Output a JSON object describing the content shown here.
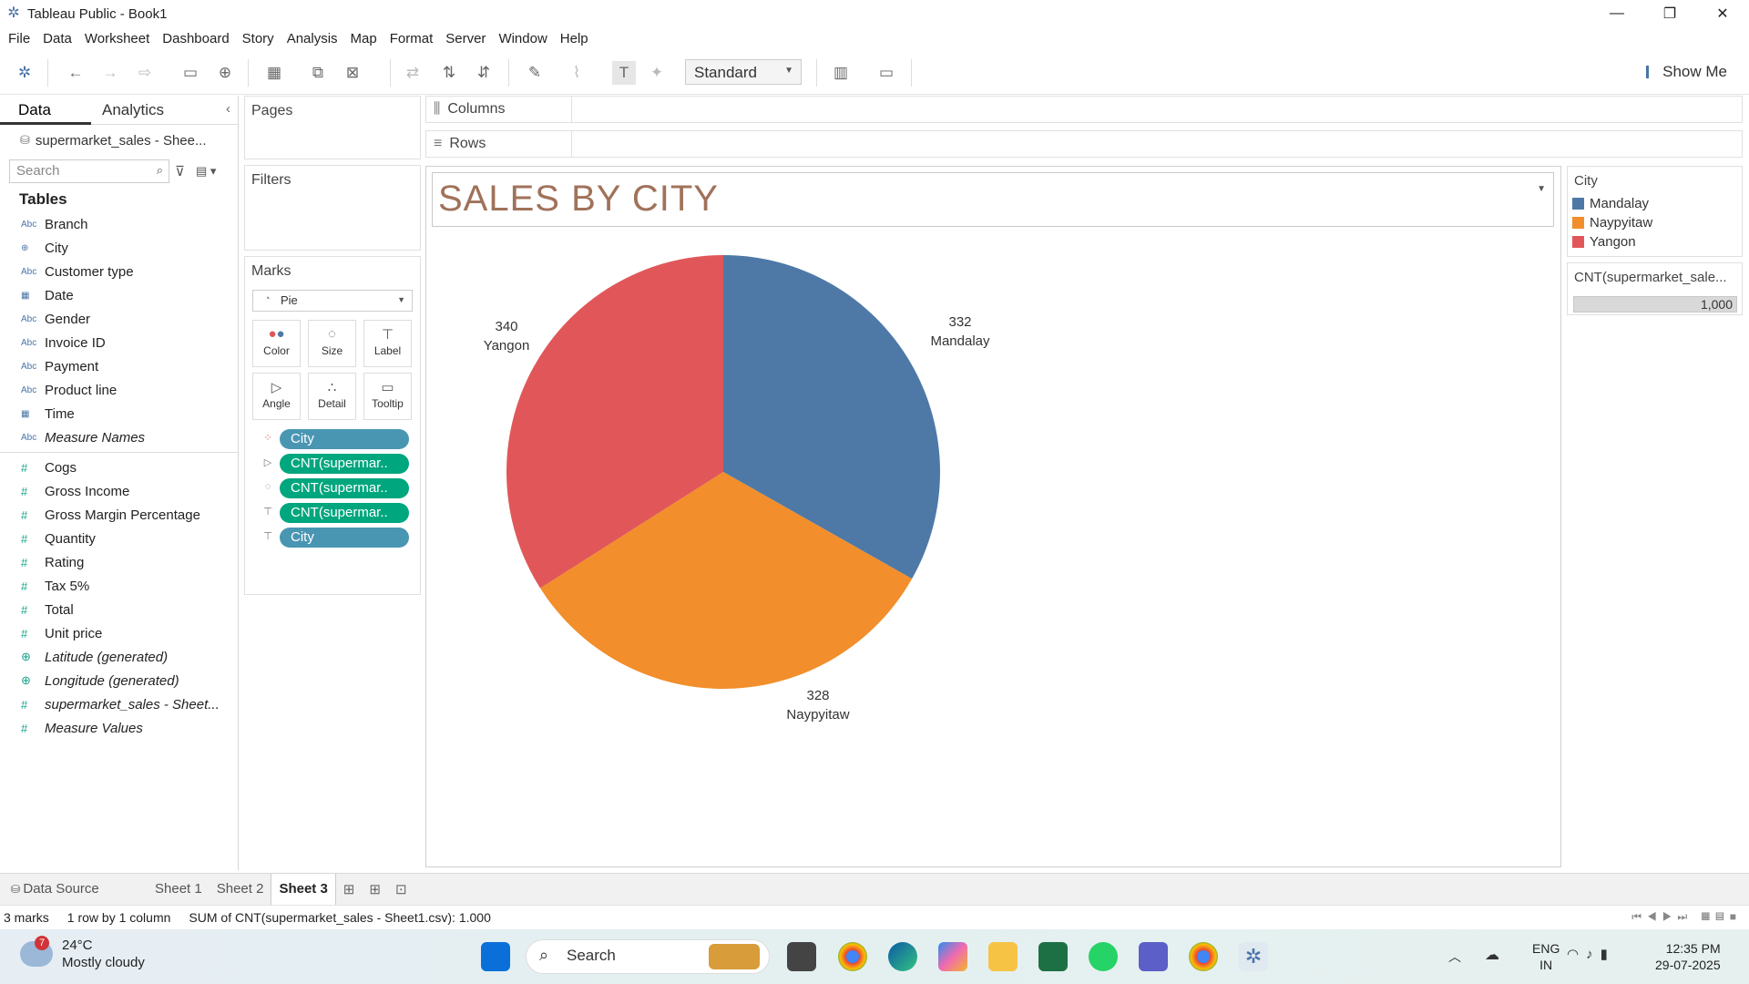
{
  "window": {
    "title": "Tableau Public - Book1"
  },
  "menu": [
    "File",
    "Data",
    "Worksheet",
    "Dashboard",
    "Story",
    "Analysis",
    "Map",
    "Format",
    "Server",
    "Window",
    "Help"
  ],
  "toolbar": {
    "fit_select": "Standard",
    "show_me": "Show Me"
  },
  "data_pane": {
    "tabs": [
      "Data",
      "Analytics"
    ],
    "datasource": "supermarket_sales - Shee...",
    "search_placeholder": "Search",
    "tables_heading": "Tables",
    "dimensions": [
      {
        "name": "Branch",
        "type": "Abc"
      },
      {
        "name": "City",
        "type": "geo"
      },
      {
        "name": "Customer type",
        "type": "Abc"
      },
      {
        "name": "Date",
        "type": "date"
      },
      {
        "name": "Gender",
        "type": "Abc"
      },
      {
        "name": "Invoice ID",
        "type": "Abc"
      },
      {
        "name": "Payment",
        "type": "Abc"
      },
      {
        "name": "Product line",
        "type": "Abc"
      },
      {
        "name": "Time",
        "type": "datetime"
      },
      {
        "name": "Measure Names",
        "type": "Abc",
        "italic": true
      }
    ],
    "measures": [
      {
        "name": "Cogs"
      },
      {
        "name": "Gross Income"
      },
      {
        "name": "Gross Margin Percentage"
      },
      {
        "name": "Quantity"
      },
      {
        "name": "Rating"
      },
      {
        "name": "Tax 5%"
      },
      {
        "name": "Total"
      },
      {
        "name": "Unit price"
      },
      {
        "name": "Latitude (generated)",
        "italic": true,
        "geo": true
      },
      {
        "name": "Longitude (generated)",
        "italic": true,
        "geo": true
      },
      {
        "name": "supermarket_sales - Sheet...",
        "italic": true
      },
      {
        "name": "Measure Values",
        "italic": true
      }
    ]
  },
  "shelves": {
    "pages": "Pages",
    "filters": "Filters",
    "marks": "Marks",
    "columns": "Columns",
    "rows": "Rows"
  },
  "marks": {
    "type": "Pie",
    "buttons": [
      "Color",
      "Size",
      "Label",
      "Angle",
      "Detail",
      "Tooltip"
    ],
    "pills": [
      {
        "label": "City",
        "kind": "dim",
        "role": "color"
      },
      {
        "label": "CNT(supermar..",
        "kind": "meas",
        "role": "angle"
      },
      {
        "label": "CNT(supermar..",
        "kind": "meas",
        "role": "size"
      },
      {
        "label": "CNT(supermar..",
        "kind": "meas",
        "role": "label"
      },
      {
        "label": "City",
        "kind": "dim",
        "role": "label"
      }
    ]
  },
  "sheet_title": "SALES BY CITY",
  "chart_data": {
    "type": "pie",
    "title": "SALES BY CITY",
    "categories": [
      "Mandalay",
      "Naypyitaw",
      "Yangon"
    ],
    "values": [
      332,
      328,
      340
    ],
    "colors": [
      "#4e79a7",
      "#f28e2b",
      "#e15759"
    ],
    "legend_title": "City",
    "legend_position": "right"
  },
  "size_legend": {
    "title": "CNT(supermarket_sale...",
    "value": "1,000"
  },
  "sheet_tabs": [
    "Data Source",
    "Sheet 1",
    "Sheet 2",
    "Sheet 3"
  ],
  "active_sheet": "Sheet 3",
  "status": {
    "marks": "3 marks",
    "dims": "1 row by 1 column",
    "sum": "SUM of CNT(supermarket_sales - Sheet1.csv): 1.000"
  },
  "taskbar": {
    "weather_temp": "24°C",
    "weather_desc": "Mostly cloudy",
    "weather_badge": "7",
    "search": "Search",
    "lang1": "ENG",
    "lang2": "IN",
    "time": "12:35 PM",
    "date": "29-07-2025"
  }
}
